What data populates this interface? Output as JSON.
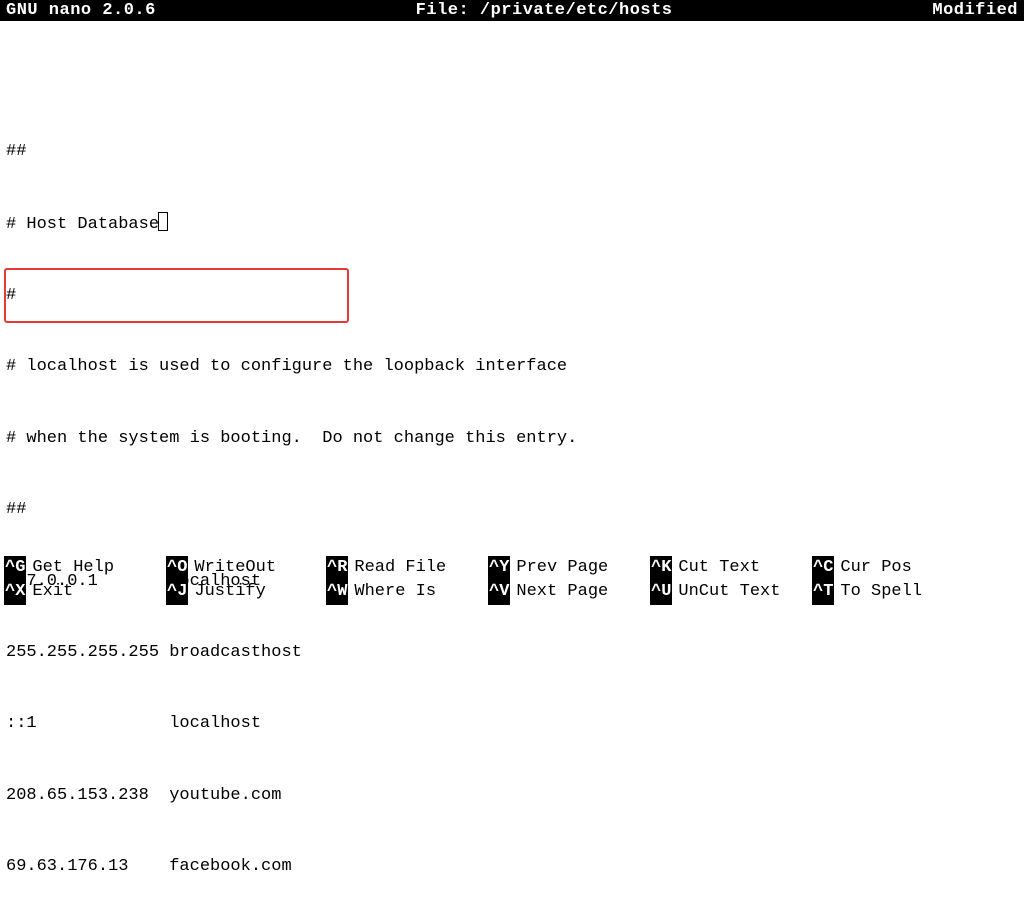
{
  "titlebar": {
    "app": "GNU nano 2.0.6",
    "file_label": "File: /private/etc/hosts",
    "status": "Modified"
  },
  "file_lines": [
    "##",
    "# Host Database",
    "#",
    "# localhost is used to configure the loopback interface",
    "# when the system is booting.  Do not change this entry.",
    "##",
    "127.0.0.1       localhost",
    "255.255.255.255 broadcasthost",
    "::1             localhost",
    "208.65.153.238  youtube.com",
    "69.63.176.13    facebook.com"
  ],
  "cursor_line_index": 1,
  "highlight": {
    "the_style": "left:4px; top:268px; width:345px; height:55px;"
  },
  "shortcuts": {
    "row0": [
      {
        "key": "^G",
        "label": "Get Help"
      },
      {
        "key": "^O",
        "label": "WriteOut"
      },
      {
        "key": "^R",
        "label": "Read File"
      },
      {
        "key": "^Y",
        "label": "Prev Page"
      },
      {
        "key": "^K",
        "label": "Cut Text"
      },
      {
        "key": "^C",
        "label": "Cur Pos"
      }
    ],
    "row1": [
      {
        "key": "^X",
        "label": "Exit"
      },
      {
        "key": "^J",
        "label": "Justify"
      },
      {
        "key": "^W",
        "label": "Where Is"
      },
      {
        "key": "^V",
        "label": "Next Page"
      },
      {
        "key": "^U",
        "label": "UnCut Text"
      },
      {
        "key": "^T",
        "label": "To Spell"
      }
    ]
  }
}
